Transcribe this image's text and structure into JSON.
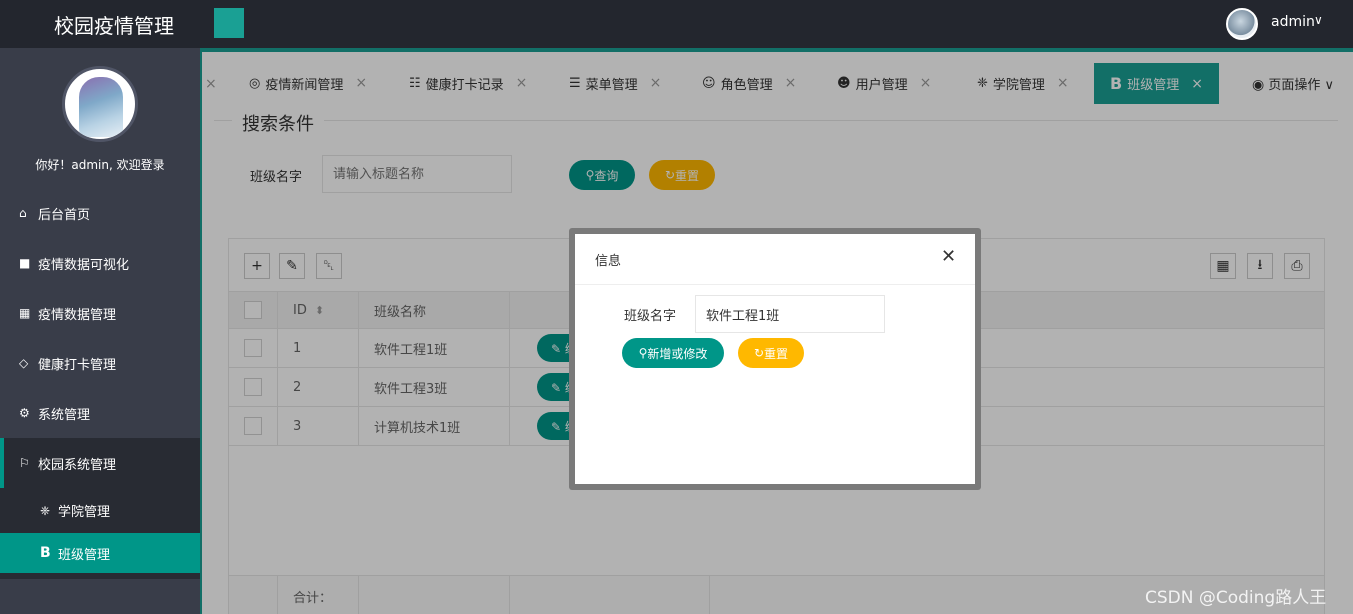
{
  "header": {
    "app_title": "校园疫情管理",
    "user_name": "admin",
    "caret": "∨"
  },
  "sidebar": {
    "welcome": "你好！admin, 欢迎登录",
    "items": [
      {
        "label": "后台首页",
        "icon": "home-icon",
        "glyph": "⌂"
      },
      {
        "label": "疫情数据可视化",
        "icon": "chart-icon",
        "glyph": "■"
      },
      {
        "label": "疫情数据管理",
        "icon": "table-icon",
        "glyph": "▦"
      },
      {
        "label": "健康打卡管理",
        "icon": "shield-icon",
        "glyph": "◇"
      },
      {
        "label": "系统管理",
        "icon": "gear-icon",
        "glyph": "⚙"
      },
      {
        "label": "校园系统管理",
        "icon": "flag-icon",
        "glyph": "⚐"
      }
    ],
    "sub_items": [
      {
        "label": "学院管理",
        "icon": "palm-icon",
        "glyph": "❈"
      },
      {
        "label": "班级管理",
        "icon": "bold-b-icon",
        "glyph": "B"
      }
    ]
  },
  "tabs": {
    "left_close": "×",
    "items": [
      {
        "label": "疫情新闻管理",
        "icon": "globe-icon",
        "glyph": "◎"
      },
      {
        "label": "健康打卡记录",
        "icon": "calendar-icon",
        "glyph": "☷"
      },
      {
        "label": "菜单管理",
        "icon": "list-icon",
        "glyph": "☰"
      },
      {
        "label": "角色管理",
        "icon": "smile-icon",
        "glyph": "☺"
      },
      {
        "label": "用户管理",
        "icon": "users-icon",
        "glyph": "☻"
      },
      {
        "label": "学院管理",
        "icon": "palm-icon",
        "glyph": "❈"
      },
      {
        "label": "班级管理",
        "icon": "bold-b-icon",
        "glyph": "B"
      }
    ],
    "close_glyph": "×",
    "page_ops": "页面操作",
    "page_ops_icon": "◉",
    "page_ops_caret": "∨"
  },
  "search": {
    "legend": "搜索条件",
    "label": "班级名字",
    "placeholder": "请输入标题名称",
    "query_button": "查询",
    "reset_button": "重置",
    "query_glyph": "⚲",
    "reset_glyph": "↻"
  },
  "toolbar": {
    "add_glyph": "+",
    "edit_glyph": "✎",
    "delete_glyph": "␡",
    "columns_glyph": "▦",
    "export_glyph": "⭳",
    "print_glyph": "⎙"
  },
  "table": {
    "columns": [
      "ID",
      "班级名称"
    ],
    "sort_glyph": "⬍",
    "rows": [
      {
        "id": "1",
        "name": "软件工程1班",
        "edit": "✎ 编"
      },
      {
        "id": "2",
        "name": "软件工程3班",
        "edit": "✎ 编"
      },
      {
        "id": "3",
        "name": "计算机技术1班",
        "edit": "✎ 编"
      }
    ],
    "total_label": "合计："
  },
  "modal": {
    "title": "信息",
    "close": "✕",
    "label": "班级名字",
    "value": "软件工程1班",
    "submit_button": "新增或修改",
    "reset_button": "重置"
  },
  "watermark": "CSDN @Coding路人王",
  "colors": {
    "accent": "#009688",
    "tab_accent": "#1aa094",
    "warning": "#ffb800",
    "sidebar": "#393d49",
    "header": "#23262e"
  }
}
